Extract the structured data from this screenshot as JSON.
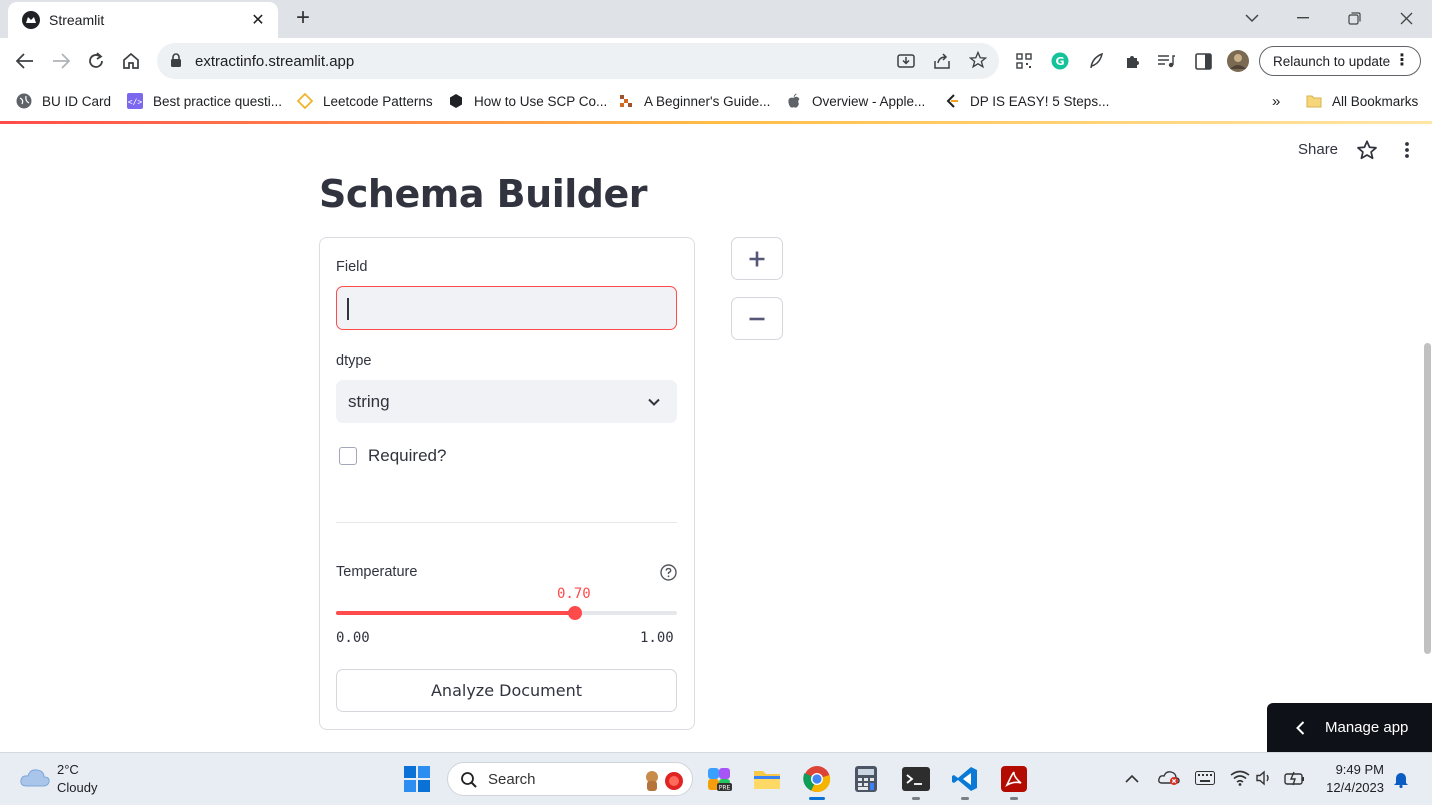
{
  "browser": {
    "tab_title": "Streamlit",
    "url": "extractinfo.streamlit.app",
    "relaunch_label": "Relaunch to update",
    "bookmarks": [
      {
        "label": "BU ID Card",
        "icon": "globe-icon"
      },
      {
        "label": "Best practice questi...",
        "icon": "code-icon"
      },
      {
        "label": "Leetcode Patterns",
        "icon": "diamond-icon"
      },
      {
        "label": "How to Use SCP Co...",
        "icon": "hexagon-icon"
      },
      {
        "label": "A Beginner's Guide...",
        "icon": "pixel-icon"
      },
      {
        "label": "Overview - Apple...",
        "icon": "apple-icon"
      },
      {
        "label": "DP IS EASY! 5 Steps...",
        "icon": "leetcode-icon"
      }
    ],
    "overflow_label": "»",
    "all_bookmarks_label": "All Bookmarks"
  },
  "app": {
    "share_label": "Share",
    "title": "Schema Builder",
    "field_label": "Field",
    "field_value": "",
    "dtype_label": "dtype",
    "dtype_value": "string",
    "required_label": "Required?",
    "required_checked": false,
    "temperature_label": "Temperature",
    "temperature_value": "0.70",
    "temperature_fraction": 0.7,
    "temperature_min": "0.00",
    "temperature_max": "1.00",
    "analyze_label": "Analyze Document",
    "add_label": "+",
    "remove_label": "−",
    "manage_label": "Manage app"
  },
  "taskbar": {
    "weather_temp": "2°C",
    "weather_desc": "Cloudy",
    "search_placeholder": "Search",
    "time": "9:49 PM",
    "date": "12/4/2023"
  },
  "colors": {
    "accent": "#ff4b4b",
    "text": "#31333f",
    "input_bg": "#f0f2f6"
  }
}
